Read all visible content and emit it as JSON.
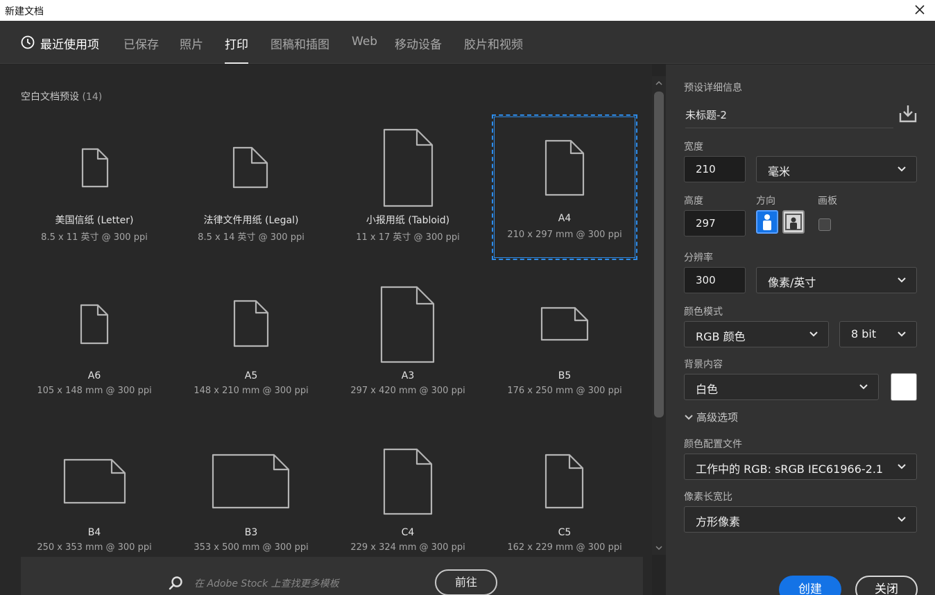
{
  "window": {
    "title": "新建文档"
  },
  "tabs": [
    {
      "label": "最近使用项"
    },
    {
      "label": "已保存"
    },
    {
      "label": "照片"
    },
    {
      "label": "打印"
    },
    {
      "label": "图稿和插图"
    },
    {
      "label": "Web"
    },
    {
      "label": "移动设备"
    },
    {
      "label": "胶片和视频"
    }
  ],
  "presets": {
    "heading": "空白文档预设",
    "count": "(14)",
    "items": [
      {
        "name": "美国信纸 (Letter)",
        "dims": "8.5 x 11 英寸 @ 300 ppi"
      },
      {
        "name": "法律文件用纸 (Legal)",
        "dims": "8.5 x 14 英寸 @ 300 ppi"
      },
      {
        "name": "小报用纸 (Tabloid)",
        "dims": "11 x 17 英寸 @ 300 ppi"
      },
      {
        "name": "A4",
        "dims": "210 x 297 mm @ 300 ppi"
      },
      {
        "name": "A6",
        "dims": "105 x 148 mm @ 300 ppi"
      },
      {
        "name": "A5",
        "dims": "148 x 210 mm @ 300 ppi"
      },
      {
        "name": "A3",
        "dims": "297 x 420 mm @ 300 ppi"
      },
      {
        "name": "B5",
        "dims": "176 x 250 mm @ 300 ppi"
      },
      {
        "name": "B4",
        "dims": "250 x 353 mm @ 300 ppi"
      },
      {
        "name": "B3",
        "dims": "353 x 500 mm @ 300 ppi"
      },
      {
        "name": "C4",
        "dims": "229 x 324 mm @ 300 ppi"
      },
      {
        "name": "C5",
        "dims": "162 x 229 mm @ 300 ppi"
      }
    ]
  },
  "stock": {
    "placeholder": "在 Adobe Stock 上查找更多模板",
    "go_label": "前往"
  },
  "details": {
    "heading": "预设详细信息",
    "doc_name": "未标题-2",
    "width_label": "宽度",
    "width_value": "210",
    "unit": "毫米",
    "height_label": "高度",
    "height_value": "297",
    "orientation_label": "方向",
    "artboard_label": "画板",
    "resolution_label": "分辨率",
    "resolution_value": "300",
    "resolution_unit": "像素/英寸",
    "color_mode_label": "颜色模式",
    "color_mode": "RGB 颜色",
    "bit_depth": "8 bit",
    "background_label": "背景内容",
    "background": "白色",
    "background_color": "#ffffff",
    "advanced_label": "高级选项",
    "profile_label": "颜色配置文件",
    "profile": "工作中的 RGB: sRGB IEC61966-2.1",
    "pixel_aspect_label": "像素长宽比",
    "pixel_aspect": "方形像素",
    "create_label": "创建",
    "close_label": "关闭"
  },
  "colors": {
    "accent": "#1473e6",
    "selection": "#2d8ceb"
  }
}
